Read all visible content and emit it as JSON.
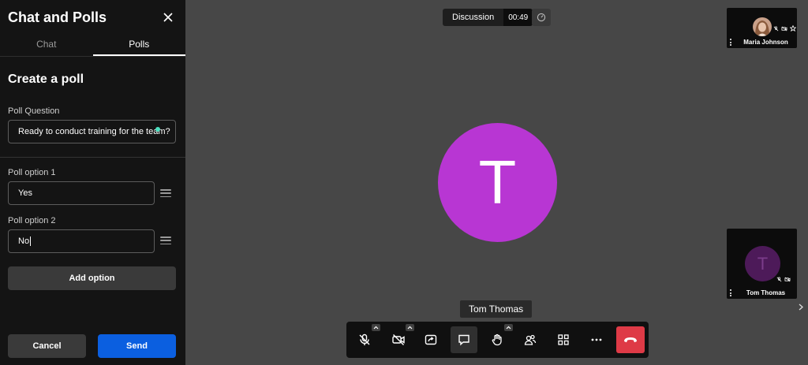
{
  "sidebar": {
    "title": "Chat and Polls",
    "tabs": [
      {
        "label": "Chat",
        "active": false
      },
      {
        "label": "Polls",
        "active": true
      }
    ],
    "create_title": "Create a poll",
    "question": {
      "label": "Poll Question",
      "value": "Ready to conduct training for the team?"
    },
    "options": [
      {
        "label": "Poll option 1",
        "value": "Yes"
      },
      {
        "label": "Poll option 2",
        "value": "No"
      }
    ],
    "add_option_label": "Add option",
    "cancel_label": "Cancel",
    "send_label": "Send"
  },
  "stage": {
    "label": "Discussion",
    "timer": "00:49"
  },
  "main_participant": {
    "initial": "T",
    "name": "Tom Thomas",
    "avatar_color": "#b836d3"
  },
  "tiles": [
    {
      "name": "Maria Johnson",
      "type": "photo"
    },
    {
      "name": "Tom Thomas",
      "initial": "T",
      "avatar_color": "#4d1a59"
    }
  ],
  "toolbar": {
    "buttons": [
      "mic-muted",
      "camera-off",
      "share-screen",
      "chat",
      "raise-hand",
      "participants",
      "tile-view",
      "more"
    ],
    "active": "chat",
    "hangup_color": "#de3a46"
  },
  "colors": {
    "accent": "#0b5fe0",
    "sidebar_bg": "#141414",
    "stage_bg": "#474747"
  }
}
